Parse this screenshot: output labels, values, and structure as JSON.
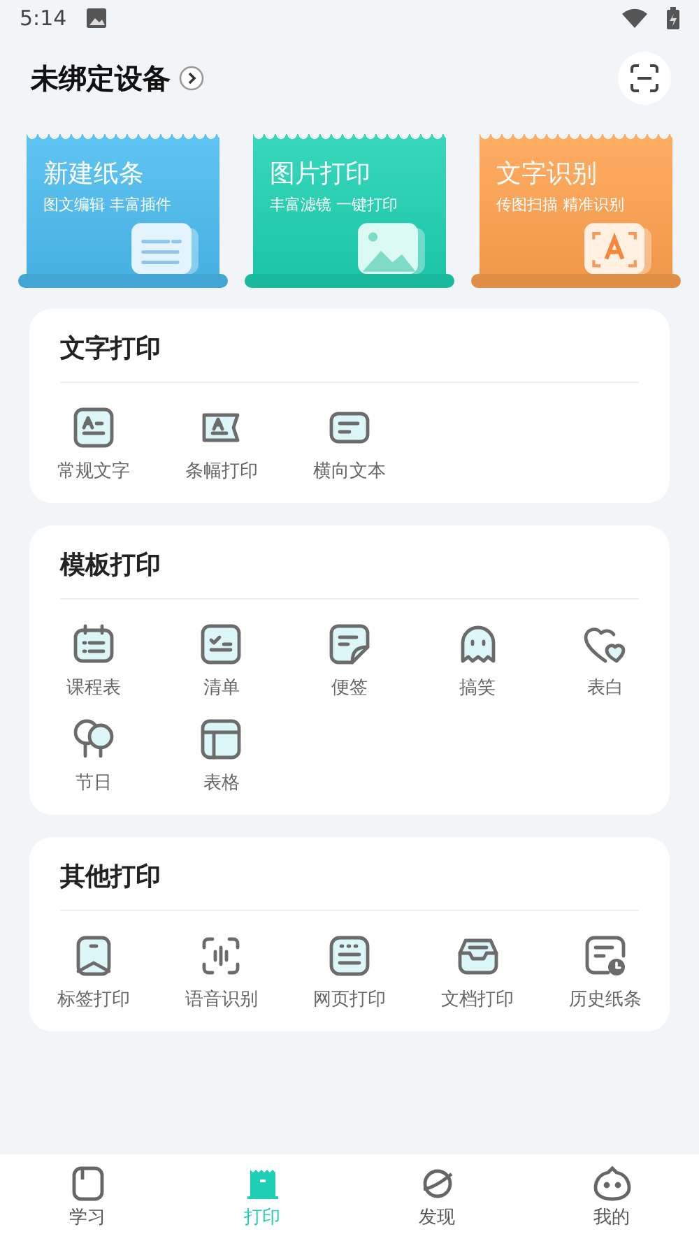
{
  "status_bar": {
    "time": "5:14"
  },
  "header": {
    "title": "未绑定设备"
  },
  "feature_cards": [
    {
      "title": "新建纸条",
      "subtitle": "图文编辑 丰富插件",
      "color": "#4bbcf0"
    },
    {
      "title": "图片打印",
      "subtitle": "丰富滤镜 一键打印",
      "color": "#1ed2b2"
    },
    {
      "title": "文字识别",
      "subtitle": "传图扫描 精准识别",
      "color": "#ffa24f"
    }
  ],
  "sections": [
    {
      "title": "文字打印",
      "items": [
        {
          "label": "常规文字"
        },
        {
          "label": "条幅打印"
        },
        {
          "label": "横向文本"
        }
      ]
    },
    {
      "title": "模板打印",
      "items": [
        {
          "label": "课程表"
        },
        {
          "label": "清单"
        },
        {
          "label": "便签"
        },
        {
          "label": "搞笑"
        },
        {
          "label": "表白"
        },
        {
          "label": "节日"
        },
        {
          "label": "表格"
        }
      ]
    },
    {
      "title": "其他打印",
      "items": [
        {
          "label": "标签打印"
        },
        {
          "label": "语音识别"
        },
        {
          "label": "网页打印"
        },
        {
          "label": "文档打印"
        },
        {
          "label": "历史纸条"
        }
      ]
    }
  ],
  "tab_bar": [
    {
      "label": "学习",
      "selected": false
    },
    {
      "label": "打印",
      "selected": true
    },
    {
      "label": "发现",
      "selected": false
    },
    {
      "label": "我的",
      "selected": false
    }
  ]
}
